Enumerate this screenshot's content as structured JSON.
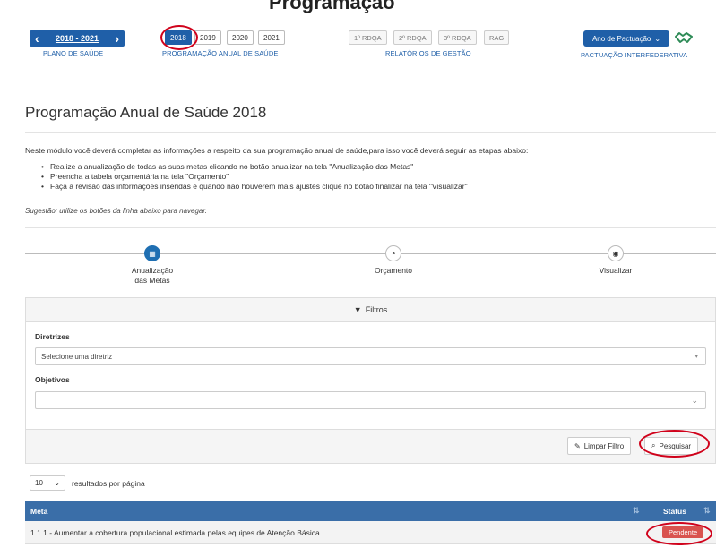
{
  "header": {
    "page_heading_partial": "Programação",
    "plan": {
      "range": "2018 - 2021",
      "caption": "PLANO DE SAÚDE"
    },
    "years": [
      "2018",
      "2019",
      "2020",
      "2021"
    ],
    "years_caption": "PROGRAMAÇÃO ANUAL DE SAÚDE",
    "reports": [
      "1º RDQA",
      "2º RDQA",
      "3º RDQA",
      "RAG"
    ],
    "reports_caption": "RELATÓRIOS DE GESTÃO",
    "pact_button": "Ano de Pactuação",
    "pact_caption": "PACTUAÇÃO INTERFEDERATIVA"
  },
  "main": {
    "title": "Programação Anual de Saúde 2018",
    "intro": "Neste módulo você deverá completar as informações a respeito da sua programação anual de saúde,para isso você deverá seguir as etapas abaixo:",
    "bullets": [
      "Realize a anualização de todas as suas metas clicando no botão anualizar na tela \"Anualização das Metas\"",
      "Preencha a tabela orçamentária na tela \"Orçamento\"",
      "Faça a revisão das informações inseridas e quando não houverem mais ajustes clique no botão finalizar na tela \"Visualizar\""
    ],
    "hint": "Sugestão: utilize os botões da linha abaixo para navegar."
  },
  "steps": [
    {
      "label_line1": "Anualização",
      "label_line2": "das Metas",
      "icon": "calendar-icon",
      "active": true
    },
    {
      "label_line1": "Orçamento",
      "label_line2": "",
      "icon": "pie-chart-icon",
      "active": false
    },
    {
      "label_line1": "Visualizar",
      "label_line2": "",
      "icon": "eye-icon",
      "active": false
    }
  ],
  "filters": {
    "heading": "Filtros",
    "diretrizes_label": "Diretrizes",
    "diretrizes_value": "Selecione uma diretriz",
    "objetivos_label": "Objetivos",
    "objetivos_value": "",
    "clear_button": "Limpar Filtro",
    "search_button": "Pesquisar"
  },
  "results": {
    "per_page": "10",
    "per_page_label": "resultados por página",
    "columns": [
      "Meta",
      "Status"
    ],
    "rows": [
      {
        "meta": "1.1.1 - Aumentar a cobertura populacional estimada pelas equipes de Atenção Básica",
        "status": "Pendente"
      }
    ]
  },
  "colors": {
    "primary": "#1f5fa8",
    "table_header": "#3a6ea8",
    "status_pending": "#d9534f",
    "annotation_red": "#d0021b"
  }
}
